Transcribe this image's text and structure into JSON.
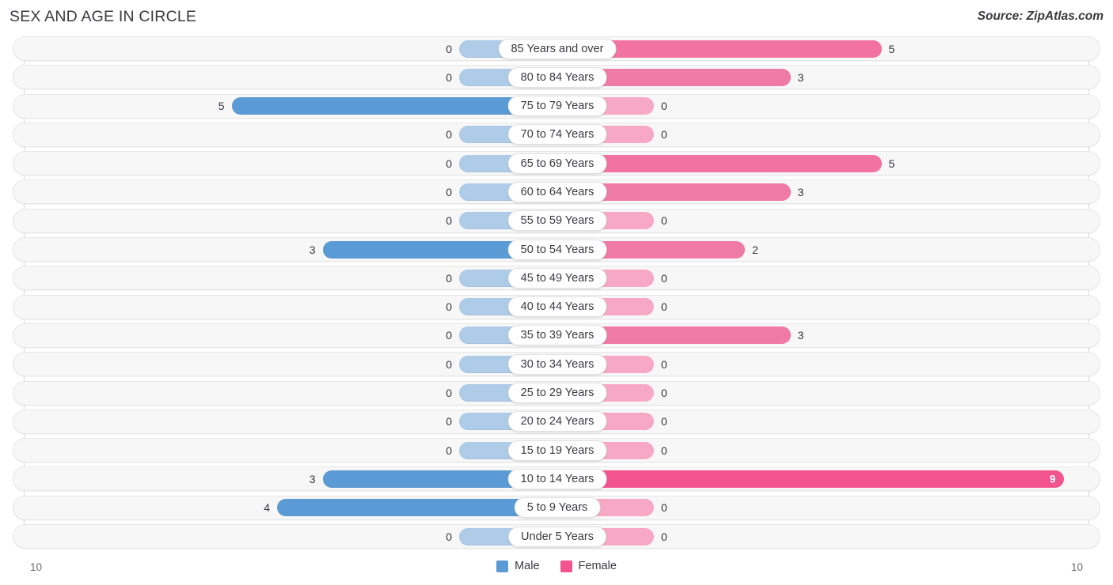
{
  "header": {
    "title": "SEX AND AGE IN CIRCLE",
    "source": "Source: ZipAtlas.com"
  },
  "axis": {
    "left_tick": "10",
    "right_tick": "10",
    "max": 10
  },
  "legend": {
    "items": [
      {
        "label": "Male",
        "color": "#5b9bd5",
        "icon": "male-swatch"
      },
      {
        "label": "Female",
        "color": "#f2548f",
        "icon": "female-swatch"
      }
    ]
  },
  "colors": {
    "male": "#5b9bd5",
    "male_zero": "#aecbe8",
    "female_high": "#f2548f",
    "female": "#f07aa6",
    "female_mid": "#f2739f",
    "female_zero": "#f7a8c4",
    "row_background": "#f7f7f7",
    "row_border": "#e7e7e7",
    "gridline": "#d9d9d9",
    "text": "#3a3a42"
  },
  "chart_data": {
    "type": "bar",
    "title": "SEX AND AGE IN CIRCLE",
    "subtitle": "Source: ZipAtlas.com",
    "xlabel": "",
    "ylabel": "",
    "orientation": "horizontal",
    "layout": "population-pyramid",
    "xlim": [
      -10,
      10
    ],
    "axis_tick_labels": [
      "10",
      "10"
    ],
    "grid": true,
    "legend_position": "bottom-center",
    "categories": [
      "85 Years and over",
      "80 to 84 Years",
      "75 to 79 Years",
      "70 to 74 Years",
      "65 to 69 Years",
      "60 to 64 Years",
      "55 to 59 Years",
      "50 to 54 Years",
      "45 to 49 Years",
      "40 to 44 Years",
      "35 to 39 Years",
      "30 to 34 Years",
      "25 to 29 Years",
      "20 to 24 Years",
      "15 to 19 Years",
      "10 to 14 Years",
      "5 to 9 Years",
      "Under 5 Years"
    ],
    "series": [
      {
        "name": "Male",
        "values": [
          0,
          0,
          5,
          0,
          0,
          0,
          0,
          3,
          0,
          0,
          0,
          0,
          0,
          0,
          0,
          3,
          4,
          0
        ]
      },
      {
        "name": "Female",
        "values": [
          5,
          3,
          0,
          0,
          5,
          3,
          0,
          2,
          0,
          0,
          3,
          0,
          0,
          0,
          0,
          9,
          0,
          0
        ]
      }
    ]
  },
  "rows": [
    {
      "label": "85 Years and over",
      "male": "0",
      "female": "5",
      "male_v": 0,
      "female_v": 5
    },
    {
      "label": "80 to 84 Years",
      "male": "0",
      "female": "3",
      "male_v": 0,
      "female_v": 3
    },
    {
      "label": "75 to 79 Years",
      "male": "5",
      "female": "0",
      "male_v": 5,
      "female_v": 0
    },
    {
      "label": "70 to 74 Years",
      "male": "0",
      "female": "0",
      "male_v": 0,
      "female_v": 0
    },
    {
      "label": "65 to 69 Years",
      "male": "0",
      "female": "5",
      "male_v": 0,
      "female_v": 5
    },
    {
      "label": "60 to 64 Years",
      "male": "0",
      "female": "3",
      "male_v": 0,
      "female_v": 3
    },
    {
      "label": "55 to 59 Years",
      "male": "0",
      "female": "0",
      "male_v": 0,
      "female_v": 0
    },
    {
      "label": "50 to 54 Years",
      "male": "3",
      "female": "2",
      "male_v": 3,
      "female_v": 2
    },
    {
      "label": "45 to 49 Years",
      "male": "0",
      "female": "0",
      "male_v": 0,
      "female_v": 0
    },
    {
      "label": "40 to 44 Years",
      "male": "0",
      "female": "0",
      "male_v": 0,
      "female_v": 0
    },
    {
      "label": "35 to 39 Years",
      "male": "0",
      "female": "3",
      "male_v": 0,
      "female_v": 3
    },
    {
      "label": "30 to 34 Years",
      "male": "0",
      "female": "0",
      "male_v": 0,
      "female_v": 0
    },
    {
      "label": "25 to 29 Years",
      "male": "0",
      "female": "0",
      "male_v": 0,
      "female_v": 0
    },
    {
      "label": "20 to 24 Years",
      "male": "0",
      "female": "0",
      "male_v": 0,
      "female_v": 0
    },
    {
      "label": "15 to 19 Years",
      "male": "0",
      "female": "0",
      "male_v": 0,
      "female_v": 0
    },
    {
      "label": "10 to 14 Years",
      "male": "3",
      "female": "9",
      "male_v": 3,
      "female_v": 9
    },
    {
      "label": "5 to 9 Years",
      "male": "4",
      "female": "0",
      "male_v": 4,
      "female_v": 0
    },
    {
      "label": "Under 5 Years",
      "male": "0",
      "female": "0",
      "male_v": 0,
      "female_v": 0
    }
  ]
}
